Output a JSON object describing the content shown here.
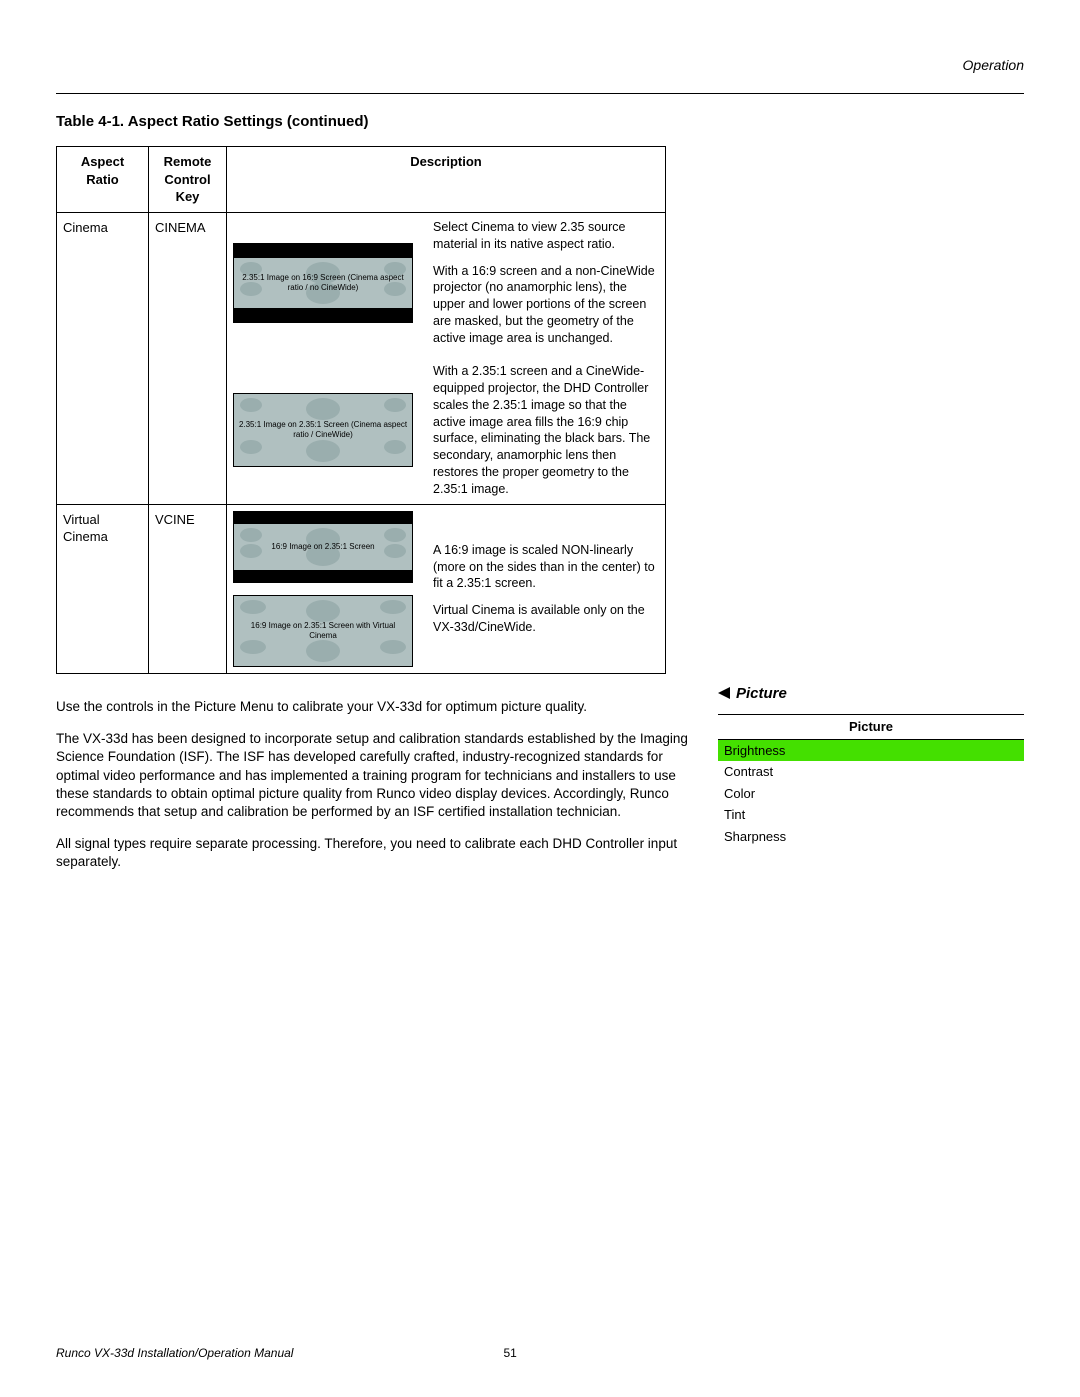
{
  "header": {
    "section": "Operation"
  },
  "table": {
    "title": "Table 4-1. Aspect Ratio Settings (continued)",
    "headers": {
      "aspect": "Aspect Ratio",
      "remote": "Remote Control Key",
      "desc": "Description"
    },
    "rows": {
      "cinema": {
        "aspect": "Cinema",
        "remote": "CINEMA",
        "diag1_caption": "2.35:1 Image on\n16:9 Screen\n(Cinema aspect ratio / no CineWide)",
        "diag2_caption": "2.35:1 Image on\n2.35:1 Screen\n(Cinema aspect ratio / CineWide)",
        "desc1_p1": "Select Cinema to view 2.35 source material in its native aspect ratio.",
        "desc1_p2": "With a 16:9 screen and a non-CineWide projector (no anamorphic lens), the upper and lower portions of the screen are masked, but the geometry of the active image area is unchanged.",
        "desc2_p1": "With a 2.35:1 screen and a CineWide-equipped projector, the DHD Controller scales the 2.35:1 image so that the active image area fills the 16:9 chip surface, eliminating the black bars. The secondary, anamorphic lens then restores the proper geometry to the 2.35:1 image."
      },
      "vcine": {
        "aspect": "Virtual Cinema",
        "remote": "VCINE",
        "diag1_caption": "16:9 Image on\n2.35:1 Screen",
        "diag2_caption": "16:9 Image on\n2.35:1 Screen with\nVirtual Cinema",
        "desc_p1": "A 16:9 image is scaled NON-linearly (more on the sides than in the center) to fit a 2.35:1 screen.",
        "desc_p2": "Virtual Cinema is available only on the VX-33d/CineWide."
      }
    }
  },
  "body": {
    "p1": "Use the controls in the Picture Menu to calibrate your VX-33d for optimum picture quality.",
    "p2": "The VX-33d has been designed to incorporate setup and calibration standards established by the Imaging Science Foundation (ISF). The ISF has developed carefully crafted, industry-recognized standards for optimal video performance and has implemented a training program for technicians and installers to use these standards to obtain optimal picture quality from Runco video display devices. Accordingly, Runco recommends that setup and calibration be performed by an ISF certified installation technician.",
    "p3": "All signal types require separate processing. Therefore, you need to calibrate each DHD Controller input separately."
  },
  "picture": {
    "callout": "Picture",
    "header": "Picture",
    "items": [
      "Brightness",
      "Contrast",
      "Color",
      "Tint",
      "Sharpness"
    ]
  },
  "footer": {
    "doc": "Runco VX-33d Installation/Operation Manual",
    "page": "51"
  }
}
